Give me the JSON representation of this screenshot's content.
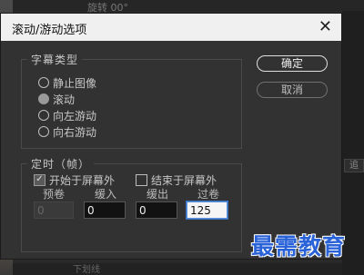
{
  "background": {
    "ghost_top_text": "旋转 00°",
    "right_fragment": "追",
    "bottom_text": "下划线"
  },
  "dialog": {
    "title": "滚动/游动选项",
    "close_glyph": "✕",
    "caption_type": {
      "legend": "字幕类型",
      "options": [
        {
          "label": "静止图像",
          "selected": false
        },
        {
          "label": "滚动",
          "selected": true
        },
        {
          "label": "向左游动",
          "selected": false
        },
        {
          "label": "向右游动",
          "selected": false
        }
      ]
    },
    "timing": {
      "legend": "定时（帧）",
      "start_offscreen": {
        "label": "开始于屏幕外",
        "checked": true
      },
      "end_offscreen": {
        "label": "结束于屏幕外",
        "checked": false
      },
      "fields": [
        {
          "label": "预卷",
          "value": "0",
          "disabled": true
        },
        {
          "label": "缓入",
          "value": "0",
          "disabled": false
        },
        {
          "label": "缓出",
          "value": "0",
          "disabled": false
        },
        {
          "label": "过卷",
          "value": "125",
          "disabled": false,
          "active": true
        }
      ]
    },
    "buttons": {
      "ok": "确定",
      "cancel": "取消"
    }
  },
  "watermark": "最需教育",
  "colors": {
    "dialog_bg": "#323232",
    "titlebar_bg": "#f0f0f0",
    "watermark": "#2a62d8"
  }
}
